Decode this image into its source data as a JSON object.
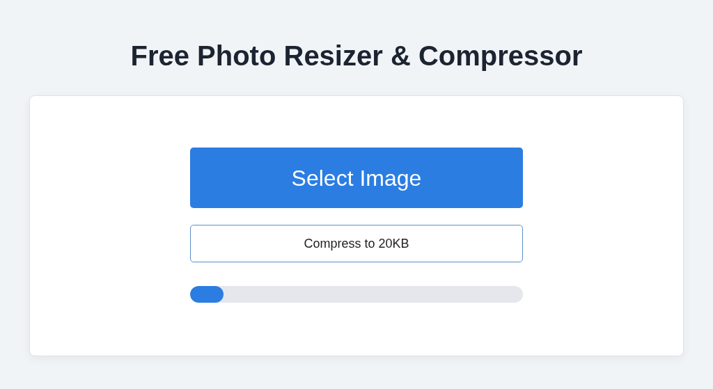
{
  "title": "Free Photo Resizer & Compressor",
  "select_button": {
    "label": "Select Image"
  },
  "compress_button": {
    "label": "Compress to 20KB"
  },
  "progress": {
    "level": 0.1
  }
}
